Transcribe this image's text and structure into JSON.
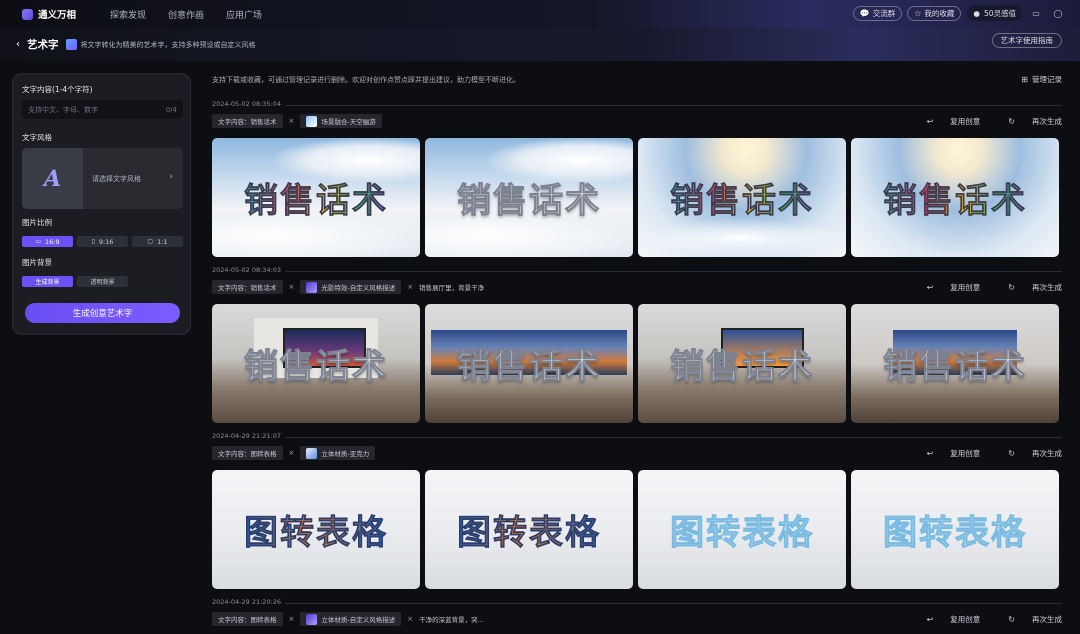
{
  "app": {
    "logo_text": "通义万相"
  },
  "top_nav": [
    "探索发现",
    "创意作画",
    "应用广场"
  ],
  "top_right": {
    "chat_group": "交流群",
    "favorites": "我的收藏",
    "credits": "50灵感值"
  },
  "subheader": {
    "back": "‹",
    "title": "艺术字",
    "description": "将文字转化为精美的艺术字，支持多种预设或自定义风格",
    "guide_button": "艺术字使用指南"
  },
  "sidebar": {
    "text_label": "文字内容(1-4个字符)",
    "text_placeholder": "支持中文、字母、数字",
    "text_counter": "0/4",
    "style_label": "文字风格",
    "style_placeholder": "请选择文字风格",
    "ratio_label": "图片比例",
    "ratios": [
      {
        "label": "16:9",
        "active": true
      },
      {
        "label": "9:16",
        "active": false
      },
      {
        "label": "1:1",
        "active": false
      }
    ],
    "bg_label": "图片背景",
    "bg_options": [
      {
        "label": "生成背景",
        "active": true
      },
      {
        "label": "透明背景",
        "active": false
      }
    ],
    "generate_button": "生成创意艺术字"
  },
  "content": {
    "notice": "支持下载或收藏，可通过管理记录进行删除。欢迎对创作点赞点踩并提出建议，助力模型不断进化。",
    "manage": "管理记录",
    "reuse_label": "复用创意",
    "regen_label": "再次生成",
    "groups": [
      {
        "timestamp": "2024-05-02 08:35:04",
        "text_tag": "文字内容：销售话术",
        "style_tag": "场景融合-天空幽游",
        "extra": "",
        "art_text": "销售话术",
        "style": "sky"
      },
      {
        "timestamp": "2024-05-02 08:34:03",
        "text_tag": "文字内容：销售话术",
        "style_tag": "光影特效-自定义风格描述",
        "extra": "销售展厅里，背景干净",
        "art_text": "销售话术",
        "style": "gallery"
      },
      {
        "timestamp": "2024-04-29 21:21:07",
        "text_tag": "文字内容：图转表格",
        "style_tag": "立体材质-亚克力",
        "extra": "",
        "art_text": "图转表格",
        "style": "acrylic"
      },
      {
        "timestamp": "2024-04-29 21:20:26",
        "text_tag": "文字内容：图转表格",
        "style_tag": "立体材质-自定义风格描述",
        "extra": "干净的深蓝背景，突...",
        "art_text": "",
        "style": "none"
      }
    ]
  },
  "colors": {
    "accent": "#6b50f5",
    "bg": "#0d0e12",
    "panel": "#1c1d22"
  }
}
